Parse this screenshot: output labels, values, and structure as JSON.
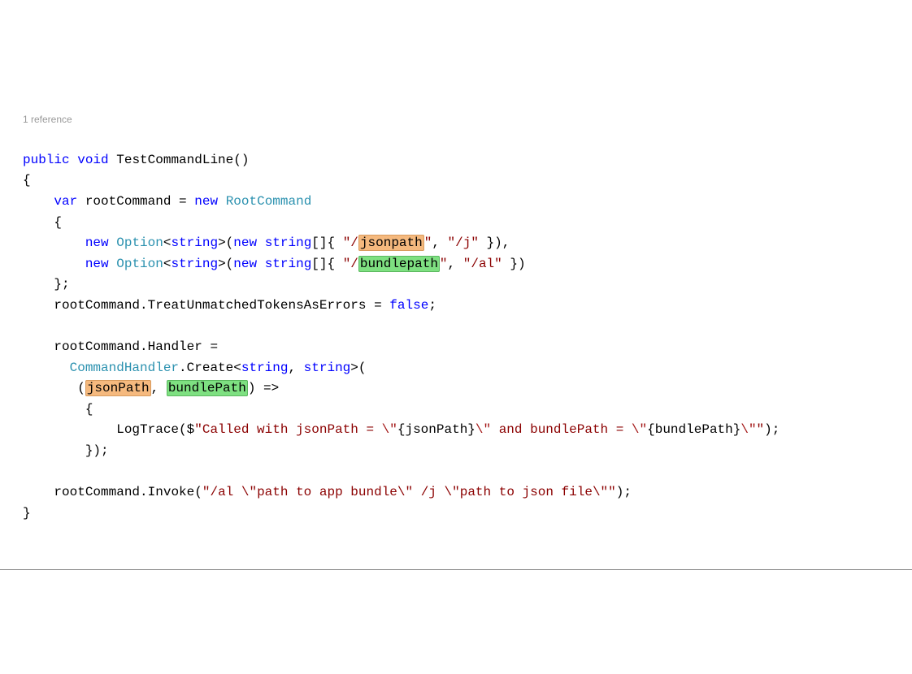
{
  "codelens": "1 reference",
  "kw": {
    "public": "public",
    "void": "void",
    "var": "var",
    "new": "new",
    "string": "string",
    "false": "false"
  },
  "types": {
    "RootCommand": "RootCommand",
    "Option": "Option",
    "CommandHandler": "CommandHandler"
  },
  "method": "TestCommandLine",
  "names": {
    "rootCommand": "rootCommand",
    "TreatUnmatched": "TreatUnmatchedTokensAsErrors",
    "Handler": "Handler",
    "Create": "Create",
    "LogTrace": "LogTrace",
    "Invoke": "Invoke"
  },
  "hl": {
    "jsonpath": "jsonpath",
    "bundlepath": "bundlepath",
    "jsonPath": "jsonPath",
    "bundlePath": "bundlePath"
  },
  "strings": {
    "slash_pre": "\"/",
    "q": "\"",
    "j_alias": "\"/j\"",
    "al_alias": "\"/al\"",
    "log_part1": "\"Called with jsonPath = ",
    "esc_q": "\\\"",
    "interp_json": "{jsonPath}",
    "log_mid": " and bundlePath = ",
    "interp_bundle": "{bundlePath}",
    "log_end": "\"",
    "invoke_arg": "\"/al \\\"path to app bundle\\\" /j \\\"path to json file\\\"\""
  }
}
